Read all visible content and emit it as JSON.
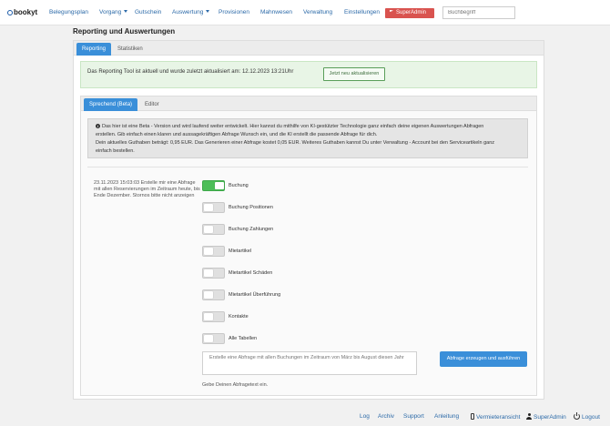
{
  "nav": {
    "logo": "bookyt",
    "items": [
      {
        "label": "Belegungsplan"
      },
      {
        "label": "Vorgang"
      },
      {
        "label": "Gutschein"
      },
      {
        "label": "Auswertung"
      },
      {
        "label": "Provisionen"
      },
      {
        "label": "Mahnwesen"
      },
      {
        "label": "Verwaltung"
      },
      {
        "label": "Einstellungen"
      }
    ],
    "superadmin_label": "SuperAdmin",
    "search_placeholder": "Buchbegriff"
  },
  "page": {
    "title": "Reporting und Auswertungen"
  },
  "outer_tabs": [
    {
      "label": "Reporting",
      "active": true
    },
    {
      "label": "Statistiken",
      "active": false
    }
  ],
  "update_notice": {
    "text": "Das Reporting Tool ist aktuell und wurde zuletzt aktualisiert am: 12.12.2023 13:21Uhr",
    "button": "Jetzt neu aktualisieren"
  },
  "inner_tabs": [
    {
      "label": "Sprechend (Beta)",
      "active": true
    },
    {
      "label": "Editor",
      "active": false
    }
  ],
  "beta_notice": {
    "line1": "Das hier ist eine Beta - Version und wird laufend weiter entwickelt. Hier kannst du mithilfe von KI-gestützter Technologie ganz einfach deine eigenen Auswertungen Abfragen",
    "line2": "erstellen. Gib einfach einen klaren und aussagekräftigen Abfrage Wunsch ein, und die KI erstellt die passende Abfrage für dich.",
    "line3": "Dein aktuelles Guthaben beträgt: 0,95 EUR. Das Generieren einer Abfrage kostet 0,05 EUR. Weiteres Guthaben kannst Du unter Verwaltung - Account bei den Serviceartikeln ganz",
    "line4": "einfach bestellen."
  },
  "last_query": "23.11.2023 15:03:03 Erstelle mir eine Abfrage mit allen Reservierungen im Zeitraum heute, bis Ende Dezember. Stornos bitte nicht anzeigen",
  "tables": [
    {
      "label": "Buchung",
      "enabled": true
    },
    {
      "label": "Buchung Positionen",
      "enabled": false
    },
    {
      "label": "Buchung Zahlungen",
      "enabled": false
    },
    {
      "label": "Mietartikel",
      "enabled": false
    },
    {
      "label": "Mietartikel Schäden",
      "enabled": false
    },
    {
      "label": "Mietartikel Überführung",
      "enabled": false
    },
    {
      "label": "Kontakte",
      "enabled": false
    },
    {
      "label": "Alle Tabellen",
      "enabled": false
    }
  ],
  "query_input": {
    "placeholder": "Erstelle eine Abfrage mit allen Buchungen im Zeitraum von März bis August diesen Jahr",
    "hint": "Gebe Deinen Abfragetext ein."
  },
  "submit_button": "Abfrage erzeugen und ausführen",
  "footer": {
    "log": "Log",
    "archiv": "Archiv",
    "support": "Support",
    "anleitung": "Anleitung",
    "vermieter": "Vermieteransicht",
    "superadmin": "SuperAdmin",
    "logout": "Logout"
  },
  "colors": {
    "primary": "#3a8fd9",
    "superadmin": "#d9534f",
    "toggle_on": "#4cbe58",
    "notice_bg": "#e8f5e6"
  }
}
